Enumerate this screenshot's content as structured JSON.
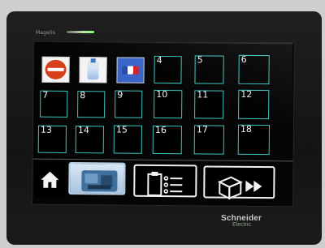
{
  "device": {
    "brand_label": "Magelis",
    "manufacturer_line1": "Schneider",
    "manufacturer_line2": "Electric"
  },
  "grid": {
    "cells": [
      {
        "number": "",
        "icon": "stop-sign-icon"
      },
      {
        "number": "",
        "icon": "bottle-icon"
      },
      {
        "number": "",
        "icon": "flag-icon"
      },
      {
        "number": "4",
        "icon": ""
      },
      {
        "number": "5",
        "icon": ""
      },
      {
        "number": "6",
        "icon": ""
      },
      {
        "number": "7",
        "icon": ""
      },
      {
        "number": "8",
        "icon": ""
      },
      {
        "number": "9",
        "icon": ""
      },
      {
        "number": "10",
        "icon": ""
      },
      {
        "number": "11",
        "icon": ""
      },
      {
        "number": "12",
        "icon": ""
      },
      {
        "number": "13",
        "icon": ""
      },
      {
        "number": "14",
        "icon": ""
      },
      {
        "number": "15",
        "icon": ""
      },
      {
        "number": "16",
        "icon": ""
      },
      {
        "number": "17",
        "icon": ""
      },
      {
        "number": "18",
        "icon": ""
      }
    ]
  },
  "bottom_bar": {
    "buttons": [
      {
        "name": "home-button",
        "icon": "home-icon",
        "selected": false
      },
      {
        "name": "machine-view-button",
        "icon": "machine-icon",
        "selected": true
      },
      {
        "name": "recipe-list-button",
        "icon": "clipboard-list-icon",
        "selected": false
      },
      {
        "name": "output-forward-button",
        "icon": "box-fast-forward-icon",
        "selected": false
      }
    ]
  },
  "colors": {
    "cell_border": "#3fc5bf",
    "screen_bg": "#050505",
    "selected_button": "#a9c4e0"
  }
}
